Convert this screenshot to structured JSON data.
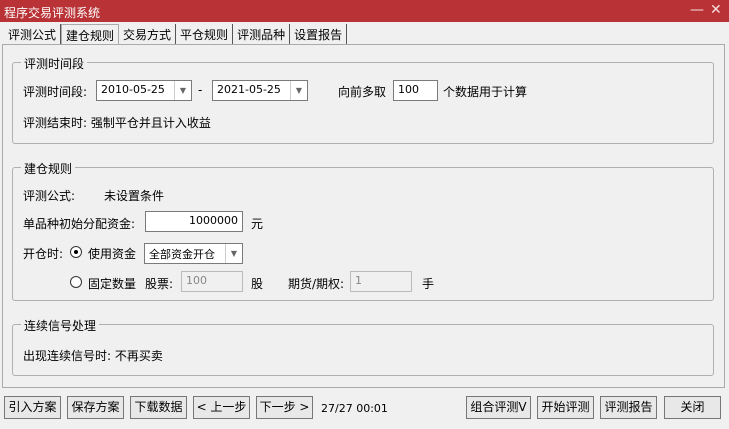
{
  "window": {
    "title": "程序交易评测系统",
    "minimize": "—",
    "close": "✕"
  },
  "tabs": [
    "评测公式",
    "建仓规则",
    "交易方式",
    "平仓规则",
    "评测品种",
    "设置报告"
  ],
  "period": {
    "legend": "评测时间段",
    "label": "评测时间段:",
    "start": "2010-05-25",
    "dash": "-",
    "end": "2021-05-25",
    "lookback_label": "向前多取",
    "lookback": "100",
    "lookback_suffix": "个数据用于计算",
    "end_rule": "评测结束时: 强制平仓并且计入收益"
  },
  "build": {
    "legend": "建仓规则",
    "formula_label": "评测公式:",
    "formula_value": "未设置条件",
    "capital_label": "单品种初始分配资金:",
    "capital": "1000000",
    "capital_unit": "元",
    "open_label": "开仓时:",
    "use_funds": "使用资金",
    "funds_option": "全部资金开仓",
    "fixed_qty": "固定数量",
    "stock_label": "股票:",
    "stock_qty": "100",
    "stock_unit": "股",
    "futures_label": "期货/期权:",
    "futures_qty": "1",
    "futures_unit": "手"
  },
  "signal": {
    "legend": "连续信号处理",
    "text": "出现连续信号时: 不再买卖"
  },
  "footer": {
    "import": "引入方案",
    "save": "保存方案",
    "download": "下载数据",
    "prev": "< 上一步",
    "next": "下一步 >",
    "status": "27/27 00:01",
    "combo": "组合评测V",
    "start": "开始评测",
    "report": "评测报告",
    "close": "关闭"
  }
}
